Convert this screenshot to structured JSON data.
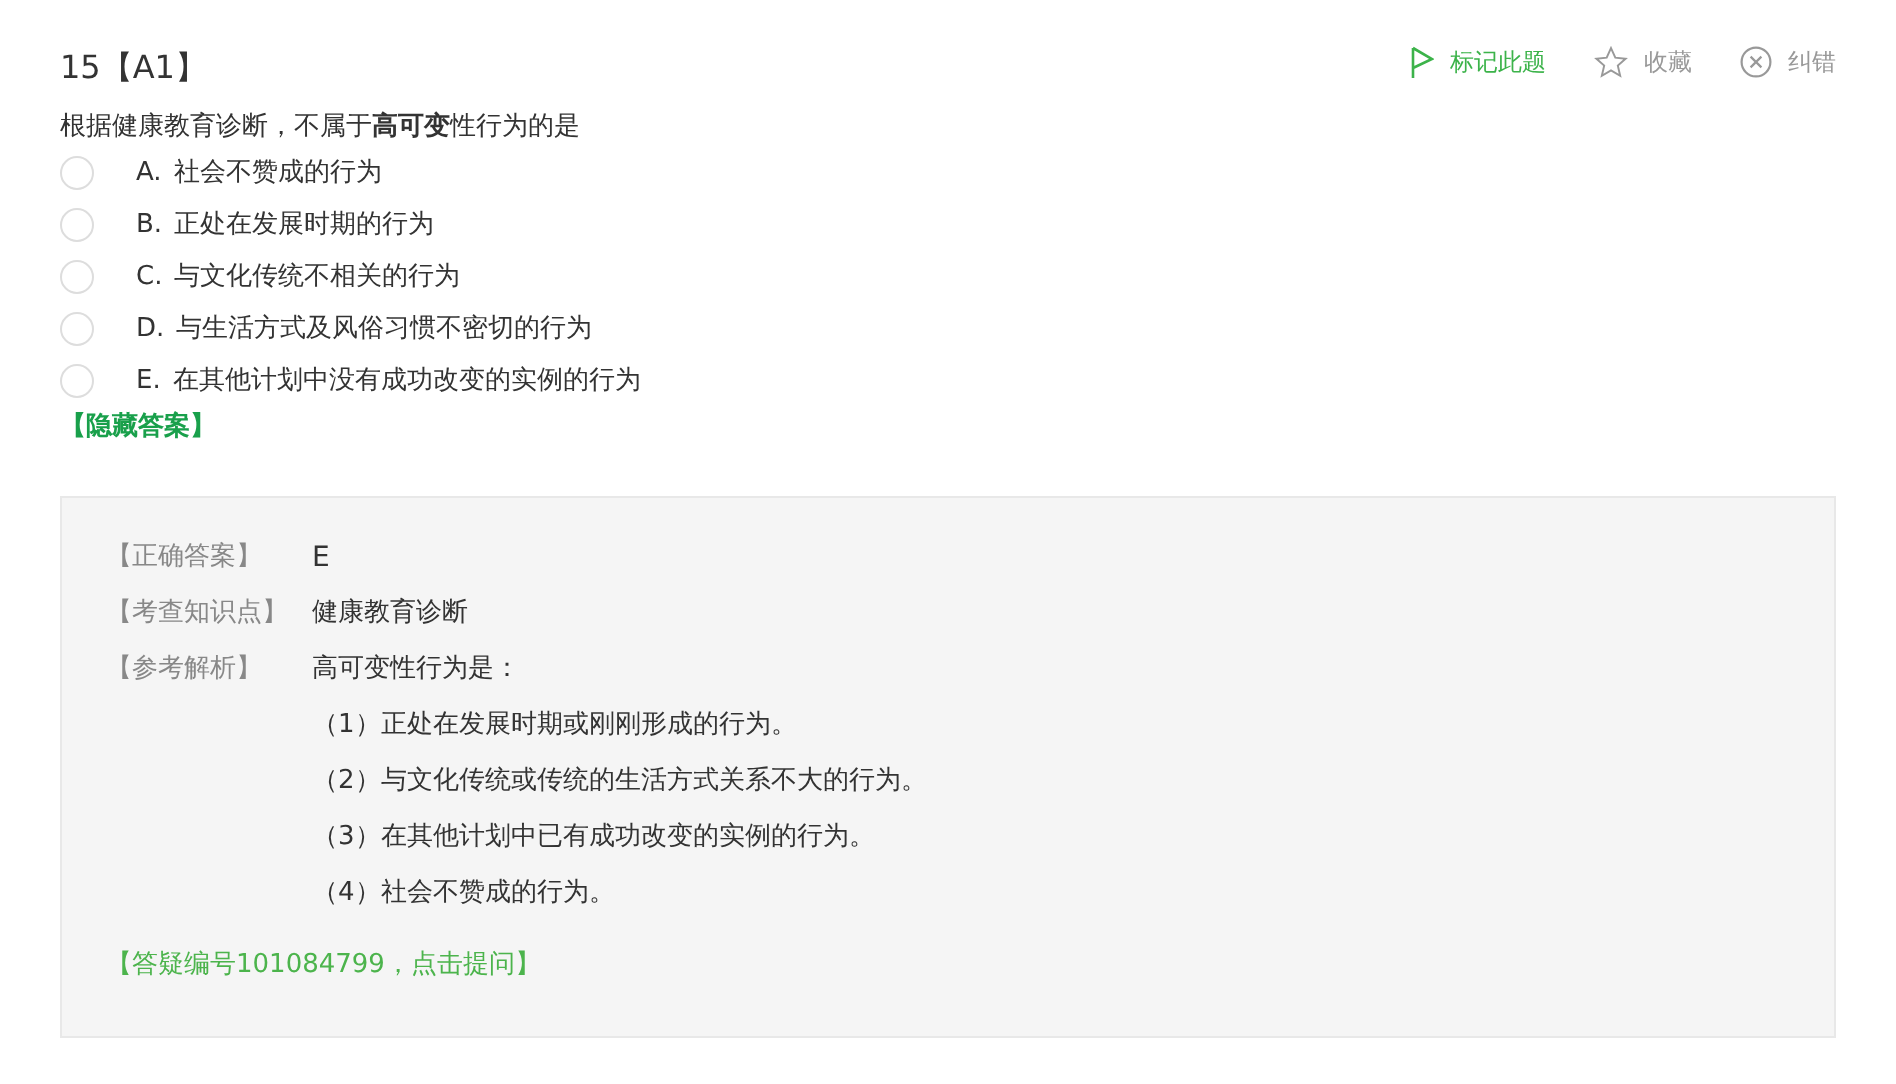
{
  "question": {
    "number": "15",
    "type": "【A1】",
    "text": "根据健康教育诊断，不属于**高可变**性行为的是"
  },
  "actions": [
    {
      "kind": "flag",
      "label": "标记此题"
    },
    {
      "kind": "star",
      "label": "收藏"
    },
    {
      "kind": "error",
      "label": "纠错"
    }
  ],
  "options": [
    {
      "letter": "A.",
      "text": "社会不赞成的行为",
      "selected": false
    },
    {
      "letter": "B.",
      "text": "正处在发展时期的行为",
      "selected": false
    },
    {
      "letter": "C.",
      "text": "与文化传统不相关的行为",
      "selected": false
    },
    {
      "letter": "D.",
      "text": "与生活方式及风俗习惯不密切的行为",
      "selected": false
    },
    {
      "letter": "E.",
      "text": "在其他计划中没有成功改变的实例的行为",
      "selected": false
    }
  ],
  "toggle_answer": "【隐藏答案】",
  "answer": {
    "rows": [
      {
        "label": "【正确答案】",
        "value": "E"
      },
      {
        "label": "【考查知识点】",
        "value": "健康教育诊断"
      },
      {
        "label": "【参考解析】",
        "value": "高可变性行为是："
      }
    ],
    "points": [
      "（1）正处在发展时期或刚刚形成的行为。",
      "（2）与文化传统或传统的生活方式关系不大的行为。",
      "（3）在其他计划中已有成功改变的实例的行为。",
      "（4）社会不赞成的行为。"
    ],
    "ask_link": "【答疑编号101084799，点击提问】"
  }
}
